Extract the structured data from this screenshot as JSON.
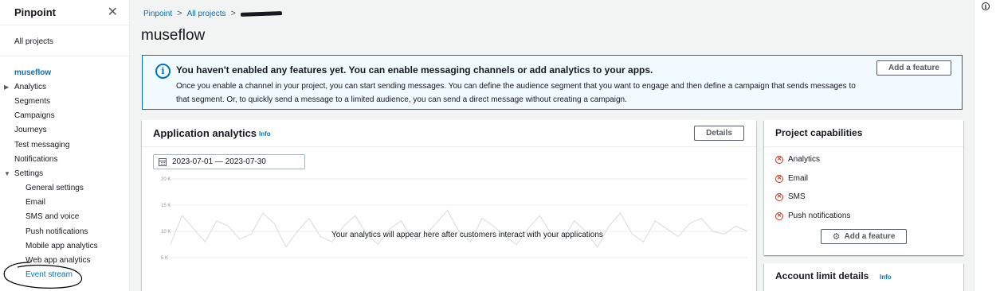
{
  "sidebar": {
    "title": "Pinpoint",
    "close_icon": "close-icon",
    "all_projects": "All projects",
    "project_name": "museflow",
    "items": [
      {
        "label": "Analytics",
        "expandable": true
      },
      {
        "label": "Segments"
      },
      {
        "label": "Campaigns"
      },
      {
        "label": "Journeys"
      },
      {
        "label": "Test messaging"
      },
      {
        "label": "Notifications"
      },
      {
        "label": "Settings",
        "expanded": true
      }
    ],
    "settings_items": [
      {
        "label": "General settings"
      },
      {
        "label": "Email"
      },
      {
        "label": "SMS and voice"
      },
      {
        "label": "Push notifications"
      },
      {
        "label": "Mobile app analytics"
      },
      {
        "label": "Web app analytics"
      },
      {
        "label": "Event stream",
        "highlighted": true
      }
    ]
  },
  "breadcrumb": {
    "items": [
      "Pinpoint",
      "All projects"
    ],
    "redacted_last": true
  },
  "page_title": "museflow",
  "info_banner": {
    "icon": "info-icon",
    "title": "You haven't enabled any features yet. You can enable messaging channels or add analytics to your apps.",
    "body": "Once you enable a channel in your project, you can start sending messages. You can define the audience segment that you want to engage and then define a campaign that sends messages to that segment. Or, to quickly send a message to a limited audience, you can send a direct message without creating a campaign.",
    "button": "Add a feature",
    "accent": "#0073bb",
    "background": "#f1faff"
  },
  "analytics": {
    "title": "Application analytics",
    "info": "Info",
    "details_button": "Details",
    "date_range": "2023-07-01 — 2023-07-30",
    "calendar_icon": "calendar-icon",
    "empty_message": "Your analytics will appear here after customers interact with your applications",
    "chart_data": {
      "type": "line",
      "title": "",
      "y_ticks": [
        "20 K",
        "15 K",
        "10 K",
        "5 K"
      ],
      "ylim": [
        0,
        20000
      ],
      "grid": true,
      "placeholder": true,
      "series": [
        {
          "values": [
            7500,
            13000,
            10500,
            8000,
            12000,
            11000,
            8500,
            9500,
            13500,
            11500,
            7000,
            10000,
            12500,
            9000,
            8000,
            11000,
            13000,
            9500,
            7500,
            10500,
            12000,
            8500,
            9000,
            11500,
            14000,
            10000,
            8000,
            12500,
            11000,
            9000,
            7500,
            10500,
            13000,
            9500,
            8500,
            12000,
            10000,
            7000,
            11000,
            13500,
            9500,
            8000,
            12000,
            10500,
            9000,
            11500,
            12500,
            10000,
            9500,
            11000,
            10000
          ]
        }
      ]
    }
  },
  "capabilities": {
    "title": "Project capabilities",
    "items": [
      "Analytics",
      "Email",
      "SMS",
      "Push notifications"
    ],
    "status_icon": "x-circle-icon",
    "status_color": "#d13212",
    "button": "Add a feature",
    "button_icon": "gear-icon"
  },
  "account_limits": {
    "title": "Account limit details",
    "info": "Info"
  },
  "help_icon": "info-icon"
}
